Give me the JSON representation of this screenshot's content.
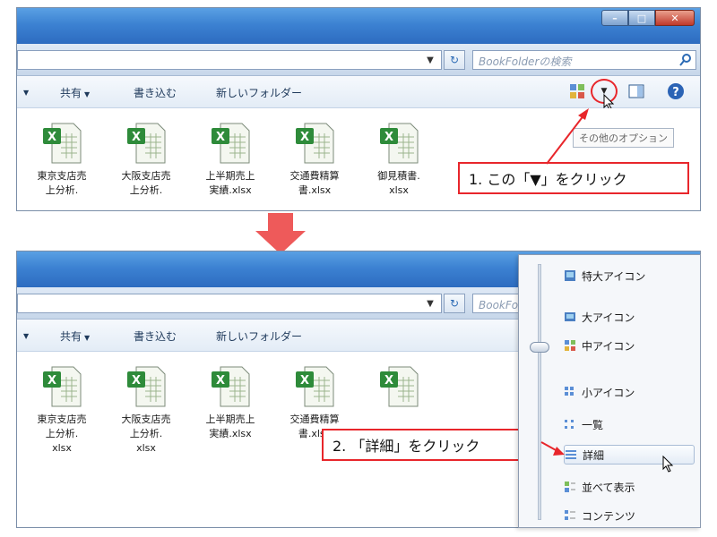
{
  "search": {
    "placeholder": "BookFolderの検索"
  },
  "toolbar": {
    "share": "共有",
    "burn": "書き込む",
    "new_folder": "新しいフォルダー"
  },
  "tooltip": "その他のオプション",
  "files": [
    {
      "line1": "東京支店売",
      "line2": "上分析.",
      "line3": "xlsx"
    },
    {
      "line1": "大阪支店売",
      "line2": "上分析.",
      "line3": "xlsx"
    },
    {
      "line1": "上半期売上",
      "line2": "実績.xlsx",
      "line3": ""
    },
    {
      "line1": "交通費精算",
      "line2": "書.xlsx",
      "line3": ""
    },
    {
      "line1": "御見積書.",
      "line2": "xlsx",
      "line3": ""
    }
  ],
  "callouts": {
    "step1": "1. この「▼」をクリック",
    "step2": "2. 「詳細」をクリック"
  },
  "view_menu": {
    "items": [
      {
        "label": "特大アイコン"
      },
      {
        "label": "大アイコン"
      },
      {
        "label": "中アイコン"
      },
      {
        "label": "小アイコン"
      },
      {
        "label": "一覧"
      },
      {
        "label": "詳細"
      },
      {
        "label": "並べて表示"
      },
      {
        "label": "コンテンツ"
      }
    ]
  },
  "colors": {
    "accent_red": "#e8262b",
    "title_blue": "#3c82d2",
    "arrow": "#ee5a5a"
  }
}
